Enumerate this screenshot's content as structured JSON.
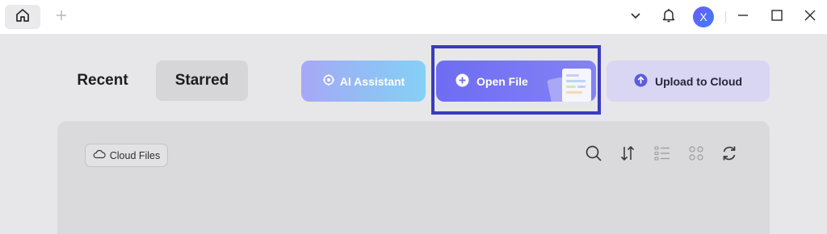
{
  "titlebar": {
    "icons": [
      "home-icon",
      "plus-icon",
      "chevron-down-icon",
      "bell-icon",
      "minimize-icon",
      "maximize-icon",
      "close-icon"
    ],
    "avatar_initial": "X",
    "avatar_color": "#5a6cff"
  },
  "main": {
    "tabs": [
      {
        "label": "Recent",
        "selected": false
      },
      {
        "label": "Starred",
        "selected": true
      }
    ],
    "actions": {
      "ai_assistant": {
        "label": "AI Assistant",
        "icon": "ai-assistant-icon"
      },
      "open_file": {
        "label": "Open File",
        "icon": "plus-circle-icon",
        "highlighted": true
      },
      "upload": {
        "label": "Upload to Cloud",
        "icon": "upload-arrow-icon"
      }
    },
    "files_panel": {
      "filter_chip": {
        "label": "Cloud Files",
        "icon": "cloud-icon"
      },
      "toolbar_icons": [
        "search-icon",
        "sort-icon",
        "list-view-icon",
        "grid-view-icon",
        "refresh-icon"
      ]
    }
  },
  "colors": {
    "accent": "#6e6cf2",
    "highlight_border": "#3a3bbd",
    "upload_bg": "#d8d6f2"
  }
}
